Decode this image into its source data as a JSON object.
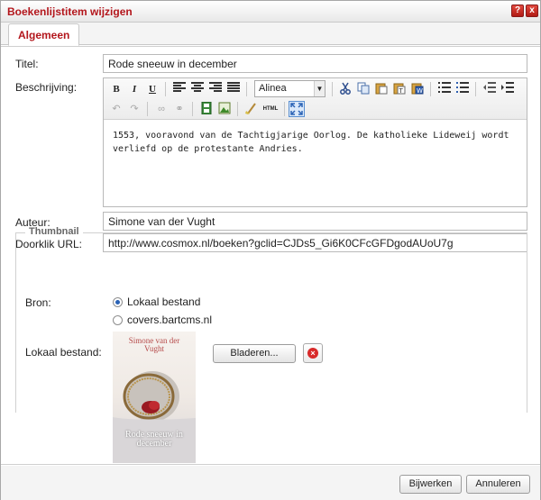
{
  "dialog": {
    "title": "Boekenlijstitem wijzigen",
    "help_icon": "?",
    "close_icon": "x"
  },
  "tabs": [
    {
      "label": "Algemeen",
      "active": true
    }
  ],
  "form": {
    "title_label": "Titel:",
    "title_value": "Rode sneeuw in december",
    "description_label": "Beschrijving:",
    "description_text": "1553, vooravond van de Tachtigjarige Oorlog. De katholieke Lideweij wordt verliefd op de protestante Andries.",
    "author_label": "Auteur:",
    "author_value": "Simone van der Vught",
    "url_label": "Doorklik URL:",
    "url_value": "http://www.cosmox.nl/boeken?gclid=CJDs5_Gi6K0CFcGFDgodAUoU7g"
  },
  "editor_toolbar": {
    "bold": "B",
    "italic": "I",
    "underline": "U",
    "format_select": "Alinea",
    "html_label": "HTML"
  },
  "thumbnail": {
    "legend": "Thumbnail",
    "source_label": "Bron:",
    "option_local": "Lokaal bestand",
    "option_remote": "covers.bartcms.nl",
    "selected": "Lokaal bestand",
    "local_file_label": "Lokaal bestand:",
    "browse_label": "Bladeren...",
    "cover_author": "Simone van der Vught",
    "cover_title": "Rode sneeuw in december"
  },
  "footer": {
    "update_label": "Bijwerken",
    "cancel_label": "Annuleren"
  },
  "colors": {
    "title_red": "#b3161c",
    "radio_blue": "#2a62b5",
    "delete_red": "#d82a2a"
  }
}
